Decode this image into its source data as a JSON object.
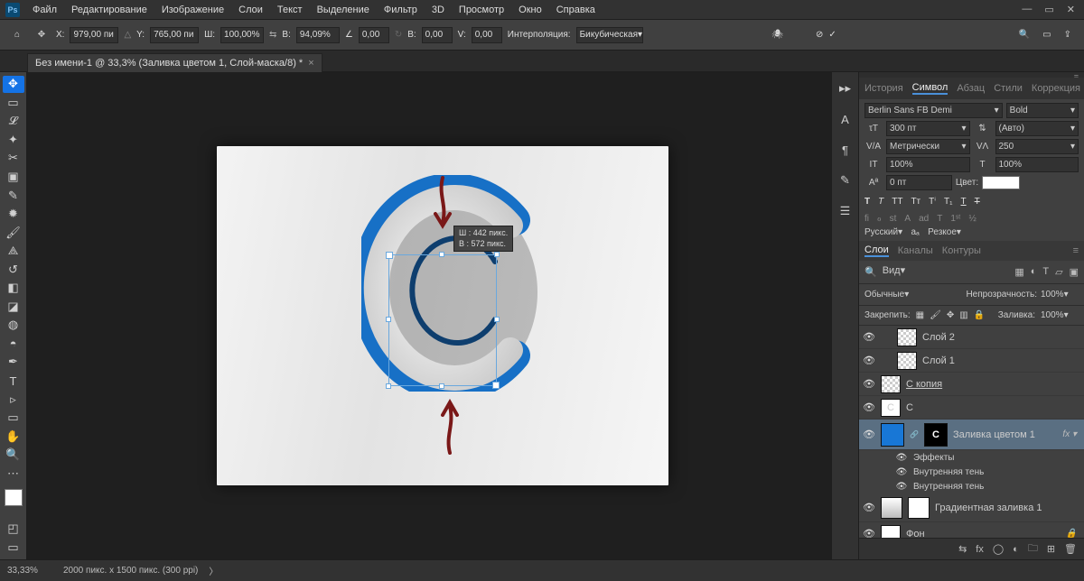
{
  "menu": [
    "Файл",
    "Редактирование",
    "Изображение",
    "Слои",
    "Текст",
    "Выделение",
    "Фильтр",
    "3D",
    "Просмотр",
    "Окно",
    "Справка"
  ],
  "options": {
    "x_label": "X:",
    "x": "979,00 пи",
    "y_label": "Y:",
    "y": "765,00 пи",
    "w_label": "Ш:",
    "w": "100,00%",
    "h_label": "В:",
    "h": "94,09%",
    "angle": "0,00",
    "hb_label": "В:",
    "hb": "0,00",
    "vb_label": "V:",
    "vb": "0,00",
    "interp_label": "Интерполяция:",
    "interp": "Бикубическая"
  },
  "doc_tab": "Без имени-1 @ 33,3% (Заливка цветом 1, Слой-маска/8) *",
  "tooltip": {
    "w_label": "Ш :",
    "w": "442 пикс.",
    "h_label": "В :",
    "h": "572 пикс."
  },
  "panels": {
    "top": [
      "История",
      "Символ",
      "Абзац",
      "Стили",
      "Коррекция"
    ],
    "char": {
      "font": "Berlin Sans FB Demi",
      "weight": "Bold",
      "size": "300 пт",
      "leading": "(Авто)",
      "tracking_label": "V/A",
      "tracking": "Метрически",
      "kerning": "250",
      "vscale": "100%",
      "baseline": "0 пт",
      "color_label": "Цвет:",
      "lang": "Русский",
      "aa": "Резкое"
    },
    "layers_tabs": [
      "Слои",
      "Каналы",
      "Контуры"
    ],
    "layers": {
      "filter": "Вид",
      "mode": "Обычные",
      "opacity_label": "Непрозрачность:",
      "opacity": "100%",
      "lock_label": "Закрепить:",
      "fill_label": "Заливка:",
      "fill": "100%",
      "items": [
        {
          "name": "Слой 2"
        },
        {
          "name": "Слой 1"
        },
        {
          "name": "С копия",
          "under": true
        },
        {
          "name": "С"
        },
        {
          "name": "Заливка цветом 1",
          "sel": true,
          "fx": true
        },
        {
          "name": "Градиентная заливка 1"
        },
        {
          "name": "Фон",
          "lock": true
        }
      ],
      "fx": {
        "title": "Эффекты",
        "items": [
          "Внутренняя тень",
          "Внутренняя тень"
        ]
      }
    }
  },
  "status": {
    "zoom": "33,33%",
    "dim": "2000 пикс. x 1500 пикс. (300 ppi)"
  }
}
